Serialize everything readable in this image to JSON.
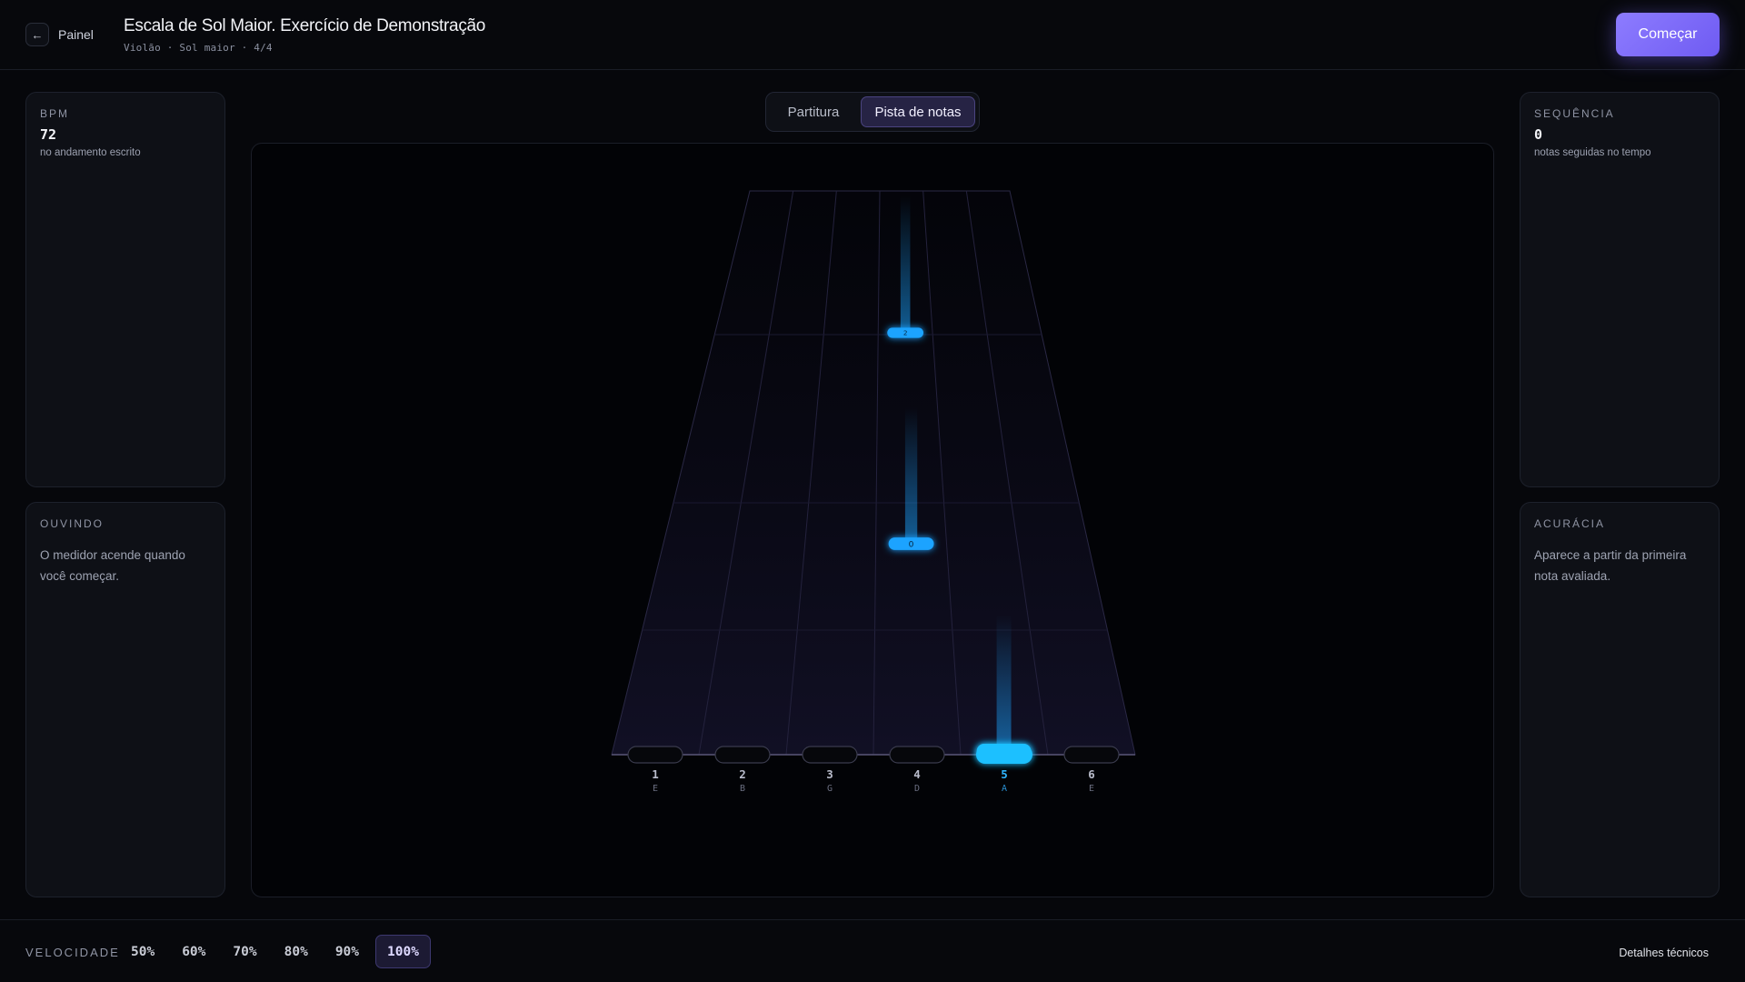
{
  "header": {
    "back_label": "Painel",
    "title": "Escala de Sol Maior. Exercício de Demonstração",
    "subtitle": "Violão · Sol maior · 4/4",
    "start_label": "Começar"
  },
  "left_panels": {
    "bpm": {
      "label": "BPM",
      "value": "72",
      "caption": "no andamento escrito"
    },
    "listening": {
      "label": "OUVINDO",
      "text": "O medidor acende quando você começar."
    }
  },
  "right_panels": {
    "sequence": {
      "label": "SEQUÊNCIA",
      "value": "0",
      "caption": "notas seguidas no tempo"
    },
    "accuracy": {
      "label": "ACURÁCIA",
      "text": "Aparece a partir da primeira nota avaliada."
    }
  },
  "tabs": [
    {
      "label": "Partitura",
      "active": false
    },
    {
      "label": "Pista de notas",
      "active": true
    }
  ],
  "highway": {
    "strings": [
      {
        "number": "1",
        "note": "E",
        "active": false
      },
      {
        "number": "2",
        "note": "B",
        "active": false
      },
      {
        "number": "3",
        "note": "G",
        "active": false
      },
      {
        "number": "4",
        "note": "D",
        "active": false
      },
      {
        "number": "5",
        "note": "A",
        "active": true
      },
      {
        "number": "6",
        "note": "E",
        "active": false
      }
    ],
    "notes": [
      {
        "string": 5,
        "fret": "3",
        "beats_away": 0
      },
      {
        "string": 4,
        "fret": "0",
        "beats_away": 1
      },
      {
        "string": 4,
        "fret": "2",
        "beats_away": 2
      }
    ],
    "accent_color": "#1aa3ff"
  },
  "bottom": {
    "speed_label": "VELOCIDADE",
    "speeds": [
      "50%",
      "60%",
      "70%",
      "80%",
      "90%",
      "100%"
    ],
    "active_speed": "100%",
    "details_label": "Detalhes técnicos"
  }
}
